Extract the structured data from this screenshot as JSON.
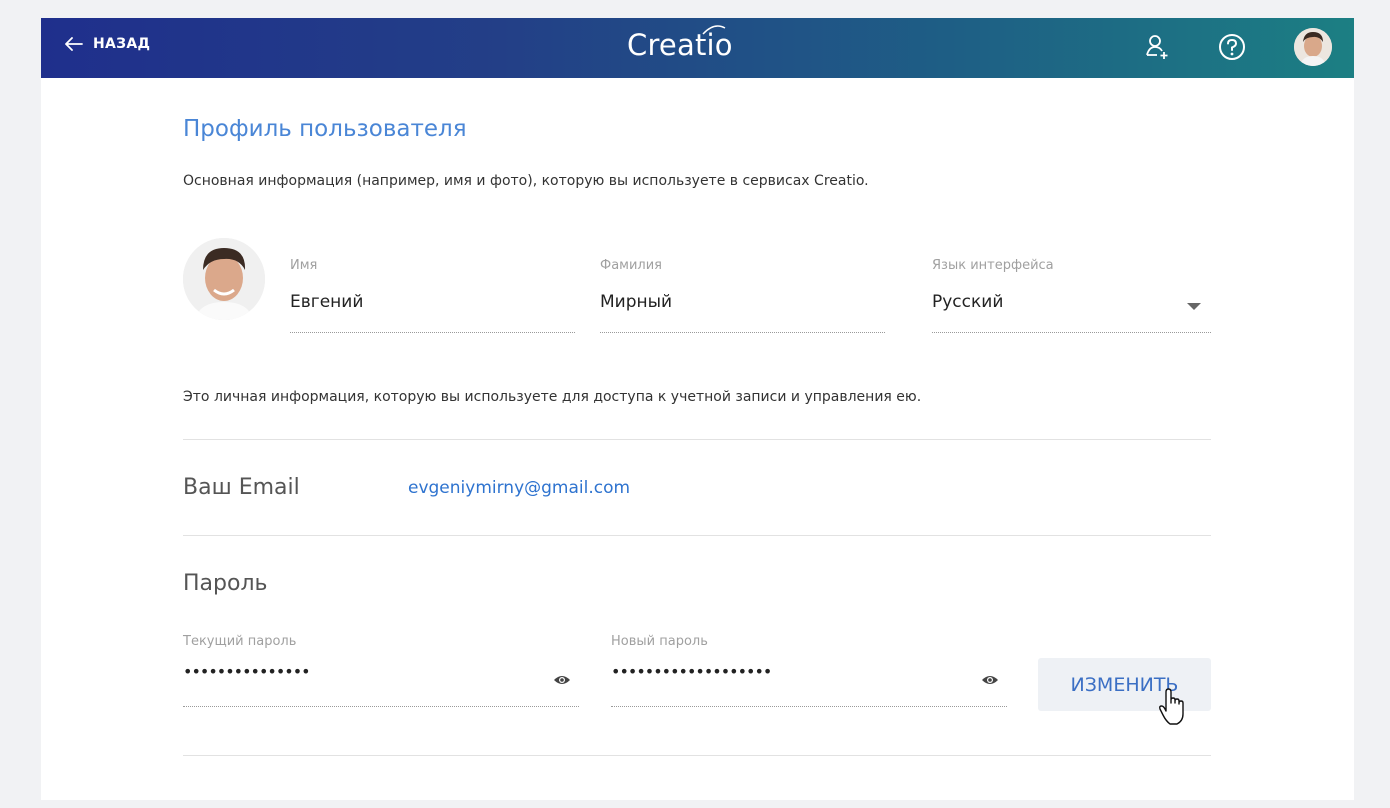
{
  "header": {
    "back_label": "НАЗАД",
    "logo_text": "Creatio",
    "icons": [
      "back-arrow-icon",
      "add-user-icon",
      "help-icon",
      "user-avatar"
    ]
  },
  "profile": {
    "title": "Профиль пользователя",
    "subtitle": "Основная информация (например, имя и фото), которую вы используете в сервисах Creatio.",
    "first_name_label": "Имя",
    "first_name_value": "Евгений",
    "last_name_label": "Фамилия",
    "last_name_value": "Мирный",
    "language_label": "Язык интерфейса",
    "language_value": "Русский"
  },
  "account": {
    "description": "Это личная информация, которую вы используете для доступа к учетной записи и управления ею.",
    "email_label": "Ваш Email",
    "email_value": "evgeniymirny@gmail.com"
  },
  "password": {
    "section_label": "Пароль",
    "current_label": "Текущий пароль",
    "current_value": "•••••••••••••••",
    "new_label": "Новый пароль",
    "new_value": "•••••••••••••••••••",
    "change_button": "ИЗМЕНИТЬ"
  },
  "colors": {
    "accent": "#4a86d6",
    "link": "#2e73cf",
    "header_start": "#1f2f8c",
    "header_end": "#1c7f83"
  }
}
